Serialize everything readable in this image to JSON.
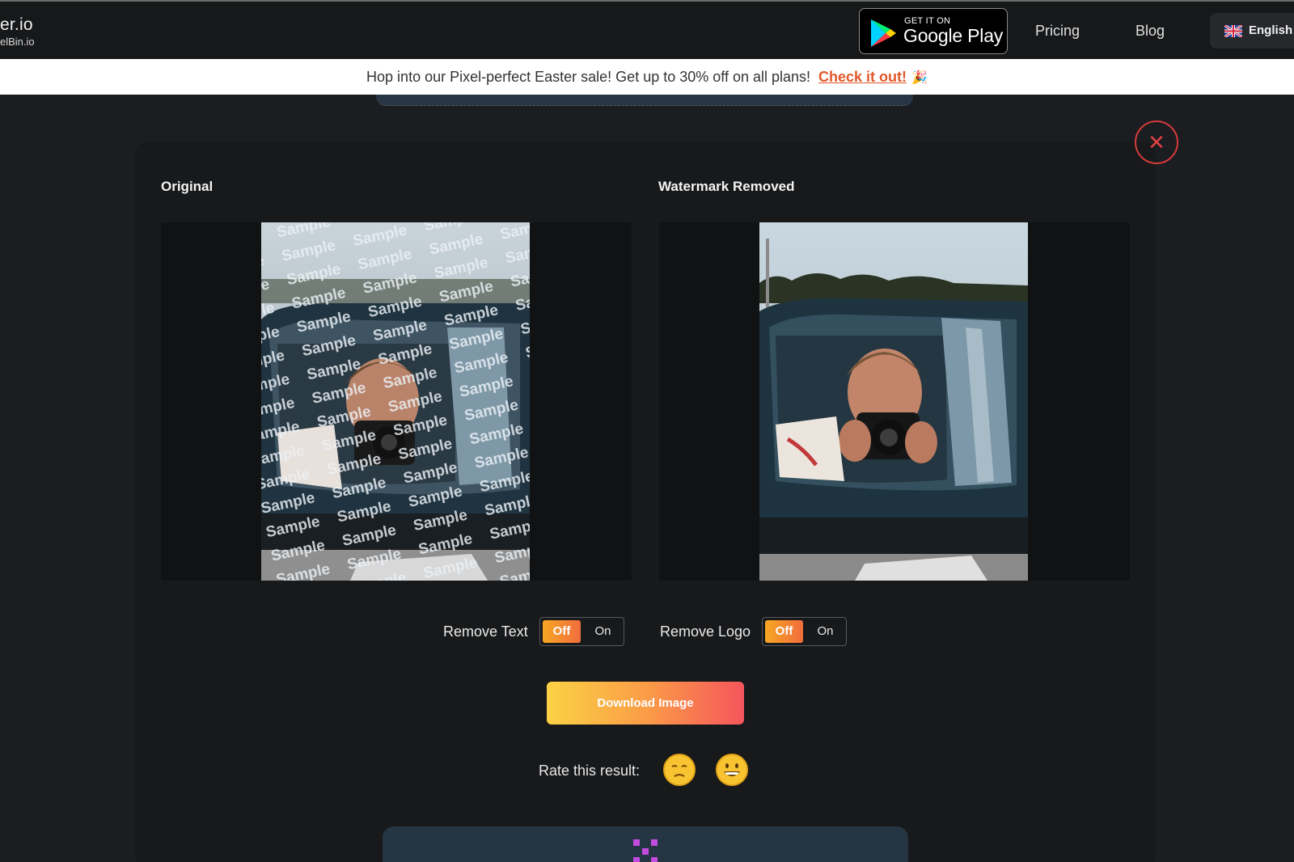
{
  "header": {
    "logo_main": "er.io",
    "logo_sub": "elBin.io",
    "google_play": {
      "small": "GET IT ON",
      "big": "Google Play"
    },
    "nav": [
      {
        "label": "Pricing"
      },
      {
        "label": "Blog"
      }
    ],
    "language": "English"
  },
  "banner": {
    "text": "Hop into our Pixel-perfect Easter sale! Get up to 30% off on all plans!",
    "link": "Check it out!",
    "emoji": "🎉"
  },
  "panels": {
    "original_title": "Original",
    "removed_title": "Watermark Removed",
    "watermark_word": "Sample"
  },
  "toggles": [
    {
      "label": "Remove Text",
      "off": "Off",
      "on": "On",
      "state": "off"
    },
    {
      "label": "Remove Logo",
      "off": "Off",
      "on": "On",
      "state": "off"
    }
  ],
  "actions": {
    "download": "Download Image"
  },
  "rating": {
    "label": "Rate this result:",
    "options": [
      "sad-face",
      "happy-face"
    ]
  },
  "colors": {
    "accent_start": "#fbd245",
    "accent_end": "#f6555c",
    "close": "#d33a3a"
  }
}
